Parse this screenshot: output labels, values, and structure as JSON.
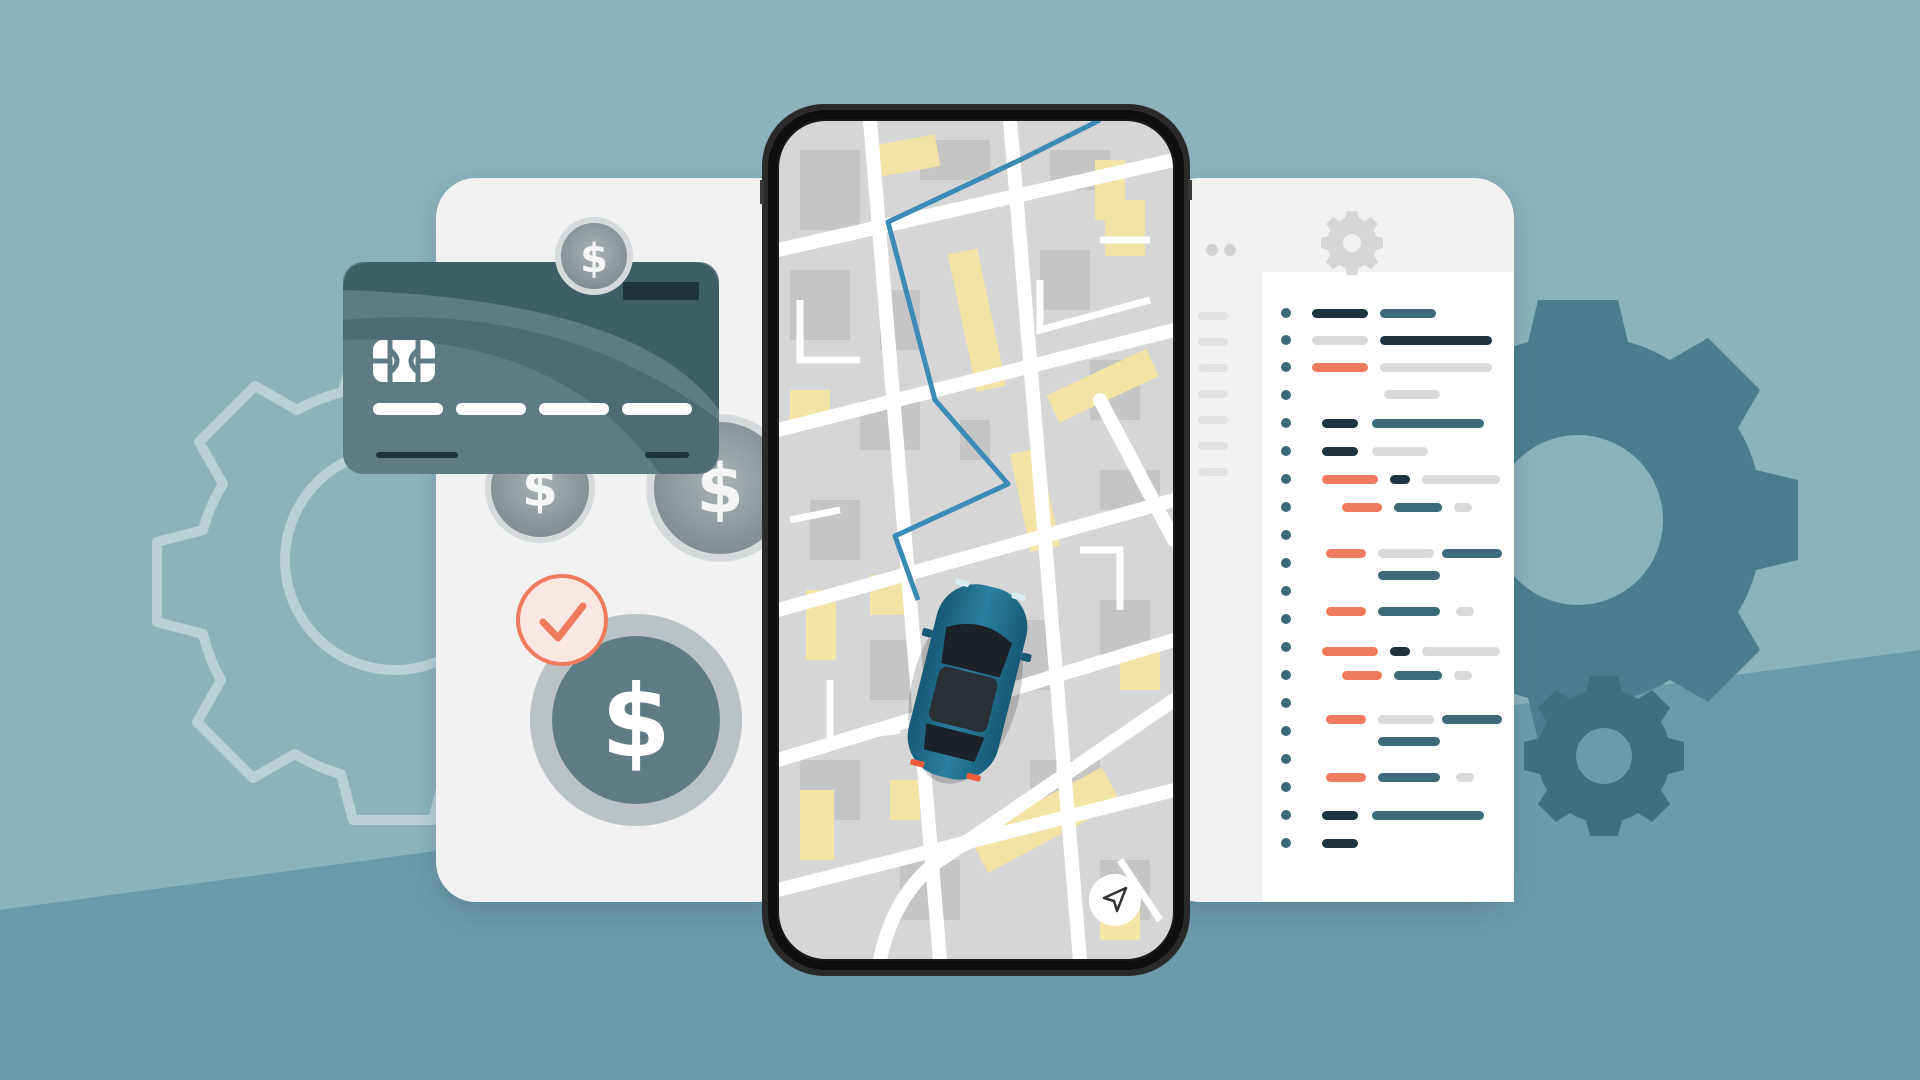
{
  "scene": {
    "kind": "illustration",
    "theme": "ride-hailing app with payment and code panels"
  },
  "colors": {
    "background_light": "#8cb2bc",
    "background_dark": "#6b9aaa",
    "gear_dark": "#4a7e8e",
    "gear_outline": "#b8d0d6",
    "panel_bg": "#f1f1f1",
    "card_dark": "#3f5f68",
    "card_mid": "#5f7c84",
    "coin": "#8f9a9d",
    "accent_orange": "#f07a5e",
    "code_dark": "#1d3440",
    "code_teal": "#3d6a78",
    "code_grey": "#d9d9d9",
    "map_bg": "#dadada",
    "map_block": "#c4c4c4",
    "map_yellow": "#f6e3a6",
    "route": "#3a8bb5",
    "car": "#1f6b8a",
    "phone_frame": "#2a2a2a"
  },
  "icons": {
    "card_chip": "card-chip-icon",
    "small_coin": "dollar-coin-icon",
    "check": "check-icon",
    "big_coin": "dollar-big-coin-icon",
    "gear_header": "gear-icon",
    "navigation": "navigation-arrow-icon",
    "car": "car-icon"
  },
  "text": {
    "currency_symbol": "$"
  }
}
